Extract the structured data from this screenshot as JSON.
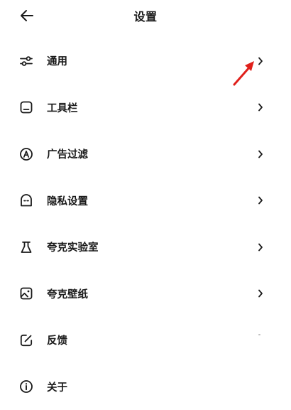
{
  "header": {
    "title": "设置",
    "back_icon": "arrow-left-icon"
  },
  "menu": {
    "items": [
      {
        "label": "通用",
        "icon": "sliders-icon",
        "chevron": true
      },
      {
        "label": "工具栏",
        "icon": "toolbar-icon",
        "chevron": true
      },
      {
        "label": "广告过滤",
        "icon": "ad-filter-icon",
        "chevron": true
      },
      {
        "label": "隐私设置",
        "icon": "privacy-icon",
        "chevron": true
      },
      {
        "label": "夸克实验室",
        "icon": "flask-icon",
        "chevron": true
      },
      {
        "label": "夸克壁纸",
        "icon": "wallpaper-icon",
        "chevron": true
      },
      {
        "label": "反馈",
        "icon": "feedback-edit-icon",
        "chevron": false
      },
      {
        "label": "关于",
        "icon": "info-icon",
        "chevron": false
      }
    ]
  },
  "annotation": {
    "arrow_color": "#e0201b"
  }
}
